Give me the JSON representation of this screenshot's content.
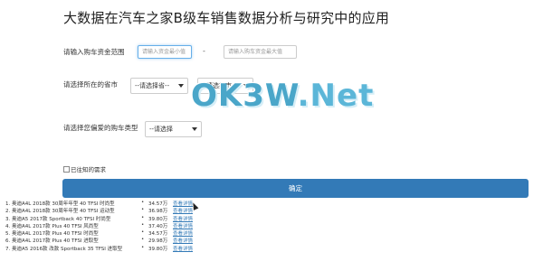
{
  "page": {
    "title": "大数据在汽车之家B级车销售数据分析与研究中的应用"
  },
  "form": {
    "budget_label": "请输入购车资金范围",
    "min_placeholder": "请输入资金最小值",
    "separator": "-",
    "max_placeholder": "请输入购车资金最大值",
    "city_label": "请选择所在的省市",
    "province_value": "--请选择省--",
    "city_value": "--请选择市--",
    "type_label": "请选择您偏爱的购车类型",
    "type_value": "--请选择",
    "checkbox_label": "已往知的需求",
    "submit_label": "确定"
  },
  "results": [
    {
      "name": "1. 奥迪A4L 2018款 30周年年型 40 TFSI 时尚型",
      "dot": "•",
      "price": "34.57万",
      "link": "查看详情"
    },
    {
      "name": "2. 奥迪A4L 2018款 30周年年型 40 TFSI 运动型",
      "dot": "•",
      "price": "36.98万",
      "link": "查看详情"
    },
    {
      "name": "3. 奥迪A5 2017款 Sportback 40 TFSI 时尚型",
      "dot": "•",
      "price": "39.80万",
      "link": "查看详情"
    },
    {
      "name": "4. 奥迪A4L 2017款 Plus 40 TFSI 风尚型",
      "dot": "•",
      "price": "37.40万",
      "link": "查看详情"
    },
    {
      "name": "5. 奥迪A4L 2017款 Plus 40 TFSI 时尚型",
      "dot": "•",
      "price": "34.57万",
      "link": "查看详情"
    },
    {
      "name": "6. 奥迪A4L 2017款 Plus 40 TFSI 进取型",
      "dot": "•",
      "price": "29.98万",
      "link": "查看详情"
    },
    {
      "name": "7. 奥迪A5 2016款 改款 Sportback 35 TFSI 进取型",
      "dot": "•",
      "price": "39.80万",
      "link": "查看详情"
    }
  ],
  "watermark": {
    "text_a": "OK3W",
    "text_b": ".Net"
  },
  "colors": {
    "button": "#337ab7",
    "link": "#337ab7",
    "focus": "#66afe9"
  }
}
